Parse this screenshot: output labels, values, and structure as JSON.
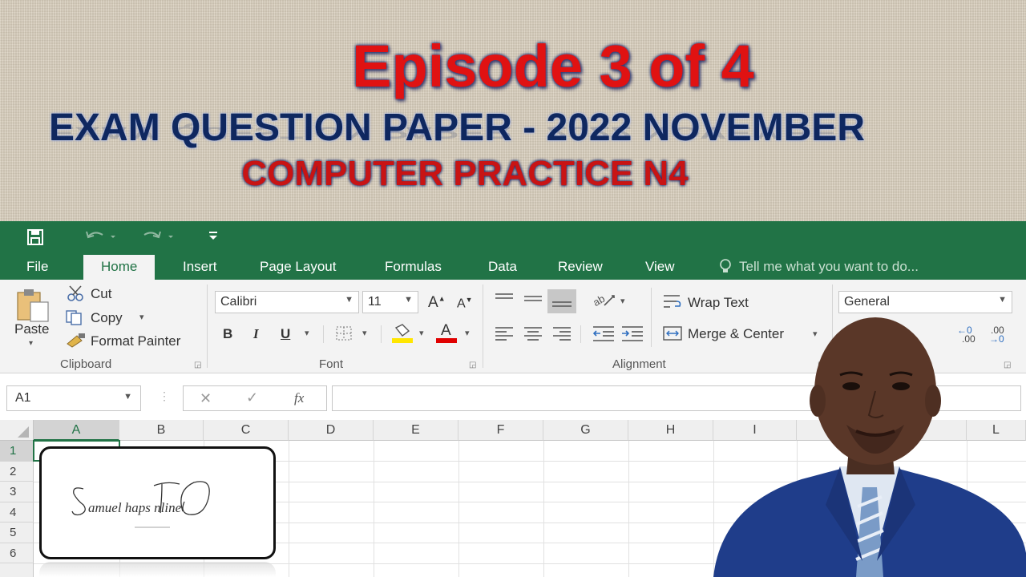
{
  "banner": {
    "episode": "Episode 3 of 4",
    "exam": "EXAM QUESTION PAPER - 2022 NOVEMBER",
    "subject": "COMPUTER PRACTICE N4"
  },
  "colors": {
    "excel_green": "#217346",
    "episode_red": "#e01212",
    "exam_navy": "#0f2860"
  },
  "qat": {
    "icons": [
      "save-icon",
      "undo-icon",
      "redo-icon",
      "customize-qat-icon"
    ]
  },
  "tabs": [
    {
      "label": "File"
    },
    {
      "label": "Home"
    },
    {
      "label": "Insert"
    },
    {
      "label": "Page Layout"
    },
    {
      "label": "Formulas"
    },
    {
      "label": "Data"
    },
    {
      "label": "Review"
    },
    {
      "label": "View"
    }
  ],
  "tell_me": "Tell me what you want to do...",
  "ribbon": {
    "clipboard": {
      "paste": "Paste",
      "cut": "Cut",
      "copy": "Copy",
      "format_painter": "Format Painter",
      "group": "Clipboard"
    },
    "font": {
      "name": "Calibri",
      "size": "11",
      "grow": "A",
      "shrink": "A",
      "bold": "B",
      "italic": "I",
      "underline": "U",
      "font_color": "A",
      "group": "Font"
    },
    "alignment": {
      "wrap_text": "Wrap Text",
      "merge_center": "Merge & Center",
      "group": "Alignment"
    },
    "number": {
      "format": "General",
      "inc_decimal": ".00",
      "dec_decimal": ".00"
    }
  },
  "formula_bar": {
    "name_box": "A1",
    "fx": "fx"
  },
  "sheet": {
    "columns": [
      "A",
      "B",
      "C",
      "D",
      "E",
      "F",
      "G",
      "H",
      "I",
      "L"
    ],
    "rows": [
      "1",
      "2",
      "3",
      "4",
      "5",
      "6"
    ],
    "active_cell": "A1"
  },
  "logo": {
    "text": "SamuelThaps Online"
  }
}
